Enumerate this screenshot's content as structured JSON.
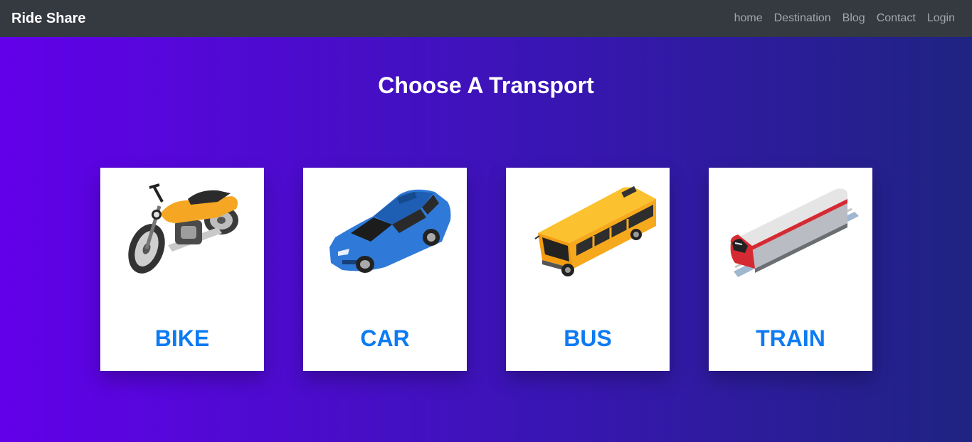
{
  "navbar": {
    "brand": "Ride Share",
    "links": [
      "home",
      "Destination",
      "Blog",
      "Contact",
      "Login"
    ]
  },
  "main": {
    "title": "Choose A Transport",
    "cards": [
      {
        "label": "BIKE",
        "icon": "motorbike-icon"
      },
      {
        "label": "CAR",
        "icon": "car-icon"
      },
      {
        "label": "BUS",
        "icon": "bus-icon"
      },
      {
        "label": "TRAIN",
        "icon": "train-icon"
      }
    ]
  },
  "colors": {
    "navbar_bg": "#343a40",
    "gradient_start": "#6200ea",
    "gradient_end": "#1f2382",
    "card_label": "#0d7bf2"
  }
}
